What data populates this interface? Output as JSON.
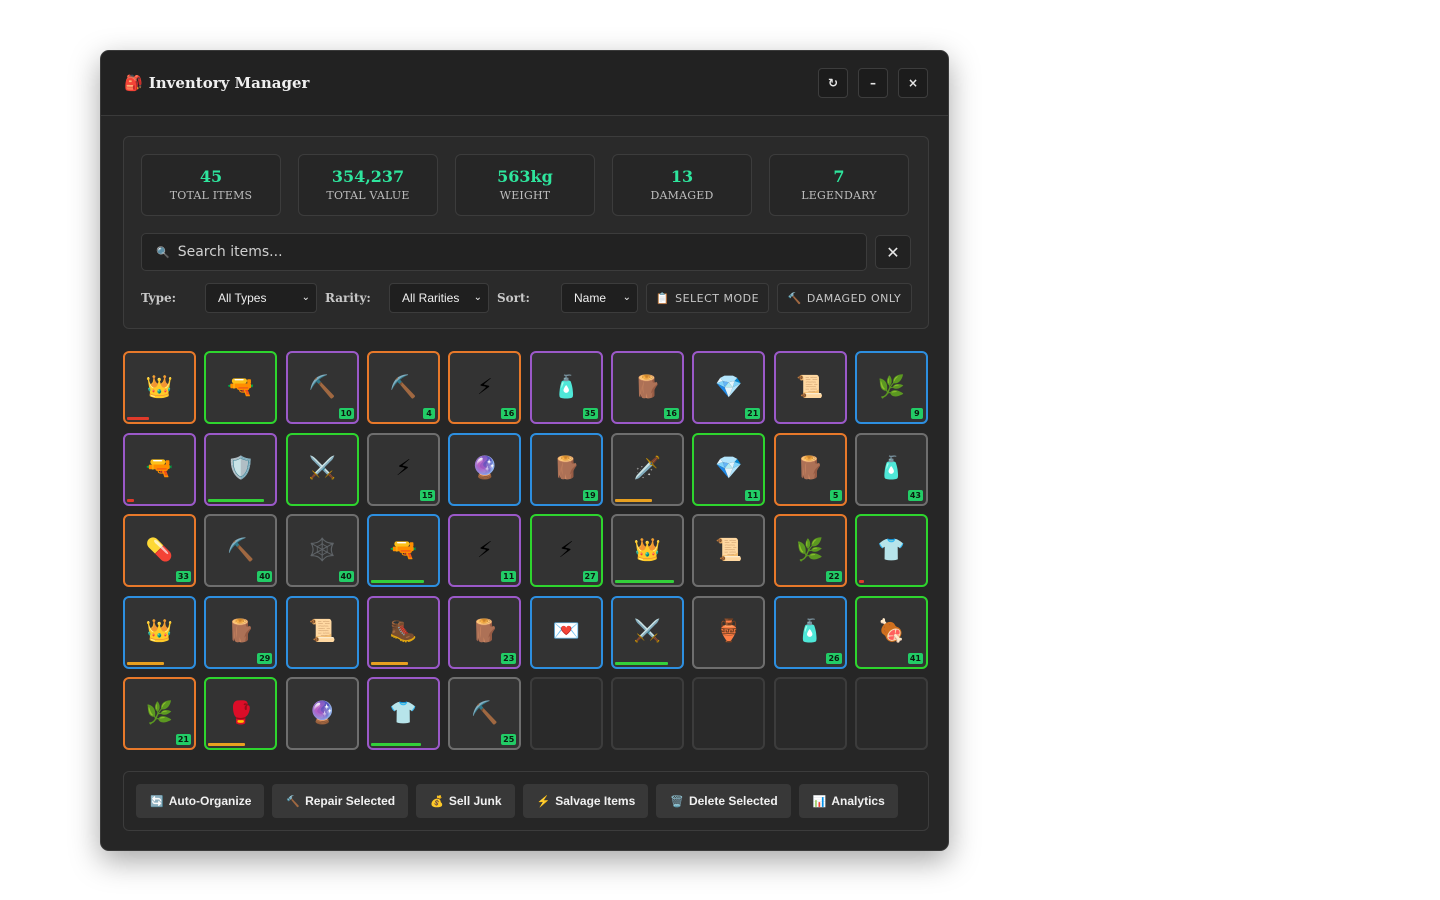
{
  "window": {
    "title": "Inventory Manager",
    "title_icon": "🎒",
    "buttons": {
      "refresh": "↻",
      "minimize": "–",
      "close": "×"
    }
  },
  "stats": [
    {
      "value": "45",
      "label": "TOTAL ITEMS"
    },
    {
      "value": "354,237",
      "label": "TOTAL VALUE"
    },
    {
      "value": "563kg",
      "label": "WEIGHT"
    },
    {
      "value": "13",
      "label": "DAMAGED"
    },
    {
      "value": "7",
      "label": "LEGENDARY"
    }
  ],
  "search": {
    "placeholder": "Search items...",
    "value": "",
    "clear": "✕",
    "icon": "🔍"
  },
  "filters": {
    "type_label": "Type:",
    "type_value": "All Types",
    "rarity_label": "Rarity:",
    "rarity_value": "All Rarities",
    "sort_label": "Sort:",
    "sort_value": "Name",
    "select_mode": "SELECT MODE",
    "select_mode_icon": "📋",
    "damaged_only": "DAMAGED ONLY",
    "damaged_only_icon": "🔨"
  },
  "colors": {
    "accent": "#2ee59d",
    "rarity": {
      "legendary": "#e8792a",
      "epic": "#9b59c9",
      "rare": "#2d8fe0",
      "uncommon": "#2ed52e",
      "common": "#6e6e6e"
    },
    "durability": {
      "low": "#e03a2a",
      "mid": "#e8a020",
      "high": "#33d03a"
    }
  },
  "inventory": [
    {
      "icon": "👑",
      "rarity": "legendary",
      "count": "",
      "durability": 0.35,
      "dura_color": "low"
    },
    {
      "icon": "🔫",
      "rarity": "uncommon",
      "count": ""
    },
    {
      "icon": "⛏️",
      "rarity": "epic",
      "count": "10"
    },
    {
      "icon": "⛏️",
      "rarity": "legendary",
      "count": "4"
    },
    {
      "icon": "⚡",
      "rarity": "legendary",
      "count": "16"
    },
    {
      "icon": "🧴",
      "rarity": "epic",
      "count": "35"
    },
    {
      "icon": "🪵",
      "rarity": "epic",
      "count": "16"
    },
    {
      "icon": "💎",
      "rarity": "epic",
      "count": "21"
    },
    {
      "icon": "📜",
      "rarity": "epic",
      "count": ""
    },
    {
      "icon": "🌿",
      "rarity": "rare",
      "count": "9"
    },
    {
      "icon": "🔫",
      "rarity": "epic",
      "count": "",
      "durability": 0.12,
      "dura_color": "low"
    },
    {
      "icon": "🛡️",
      "rarity": "epic",
      "count": "",
      "durability": 0.9,
      "dura_color": "high"
    },
    {
      "icon": "⚔️",
      "rarity": "uncommon",
      "count": ""
    },
    {
      "icon": "⚡",
      "rarity": "common",
      "count": "15"
    },
    {
      "icon": "🔮",
      "rarity": "rare",
      "count": ""
    },
    {
      "icon": "🪵",
      "rarity": "rare",
      "count": "19"
    },
    {
      "icon": "🗡️",
      "rarity": "common",
      "count": "",
      "durability": 0.6,
      "dura_color": "mid"
    },
    {
      "icon": "💎",
      "rarity": "uncommon",
      "count": "11"
    },
    {
      "icon": "🪵",
      "rarity": "legendary",
      "count": "5"
    },
    {
      "icon": "🧴",
      "rarity": "common",
      "count": "43"
    },
    {
      "icon": "💊",
      "rarity": "legendary",
      "count": "33"
    },
    {
      "icon": "⛏️",
      "rarity": "common",
      "count": "40"
    },
    {
      "icon": "🕸️",
      "rarity": "common",
      "count": "40"
    },
    {
      "icon": "🔫",
      "rarity": "rare",
      "count": "",
      "durability": 0.85,
      "dura_color": "high"
    },
    {
      "icon": "⚡",
      "rarity": "epic",
      "count": "11"
    },
    {
      "icon": "⚡",
      "rarity": "uncommon",
      "count": "27"
    },
    {
      "icon": "👑",
      "rarity": "common",
      "count": "",
      "durability": 0.95,
      "dura_color": "high"
    },
    {
      "icon": "📜",
      "rarity": "common",
      "count": ""
    },
    {
      "icon": "🌿",
      "rarity": "legendary",
      "count": "22"
    },
    {
      "icon": "👕",
      "rarity": "uncommon",
      "count": "",
      "durability": 0.08,
      "dura_color": "low"
    },
    {
      "icon": "👑",
      "rarity": "rare",
      "count": "",
      "durability": 0.6,
      "dura_color": "mid"
    },
    {
      "icon": "🪵",
      "rarity": "rare",
      "count": "29"
    },
    {
      "icon": "📜",
      "rarity": "rare",
      "count": ""
    },
    {
      "icon": "🥾",
      "rarity": "epic",
      "count": "",
      "durability": 0.6,
      "dura_color": "mid"
    },
    {
      "icon": "🪵",
      "rarity": "epic",
      "count": "23"
    },
    {
      "icon": "💌",
      "rarity": "rare",
      "count": ""
    },
    {
      "icon": "⚔️",
      "rarity": "rare",
      "count": "",
      "durability": 0.85,
      "dura_color": "high"
    },
    {
      "icon": "🏺",
      "rarity": "common",
      "count": ""
    },
    {
      "icon": "🧴",
      "rarity": "rare",
      "count": "26"
    },
    {
      "icon": "🍖",
      "rarity": "uncommon",
      "count": "41"
    },
    {
      "icon": "🌿",
      "rarity": "legendary",
      "count": "21"
    },
    {
      "icon": "🥊",
      "rarity": "uncommon",
      "count": "",
      "durability": 0.6,
      "dura_color": "mid"
    },
    {
      "icon": "🔮",
      "rarity": "common",
      "count": ""
    },
    {
      "icon": "👕",
      "rarity": "epic",
      "count": "",
      "durability": 0.8,
      "dura_color": "high"
    },
    {
      "icon": "⛏️",
      "rarity": "common",
      "count": "25"
    },
    null,
    null,
    null,
    null,
    null
  ],
  "actions": [
    {
      "icon": "🔄",
      "label": "Auto-Organize"
    },
    {
      "icon": "🔨",
      "label": "Repair Selected"
    },
    {
      "icon": "💰",
      "label": "Sell Junk"
    },
    {
      "icon": "⚡",
      "label": "Salvage Items"
    },
    {
      "icon": "🗑️",
      "label": "Delete Selected"
    },
    {
      "icon": "📊",
      "label": "Analytics"
    }
  ]
}
